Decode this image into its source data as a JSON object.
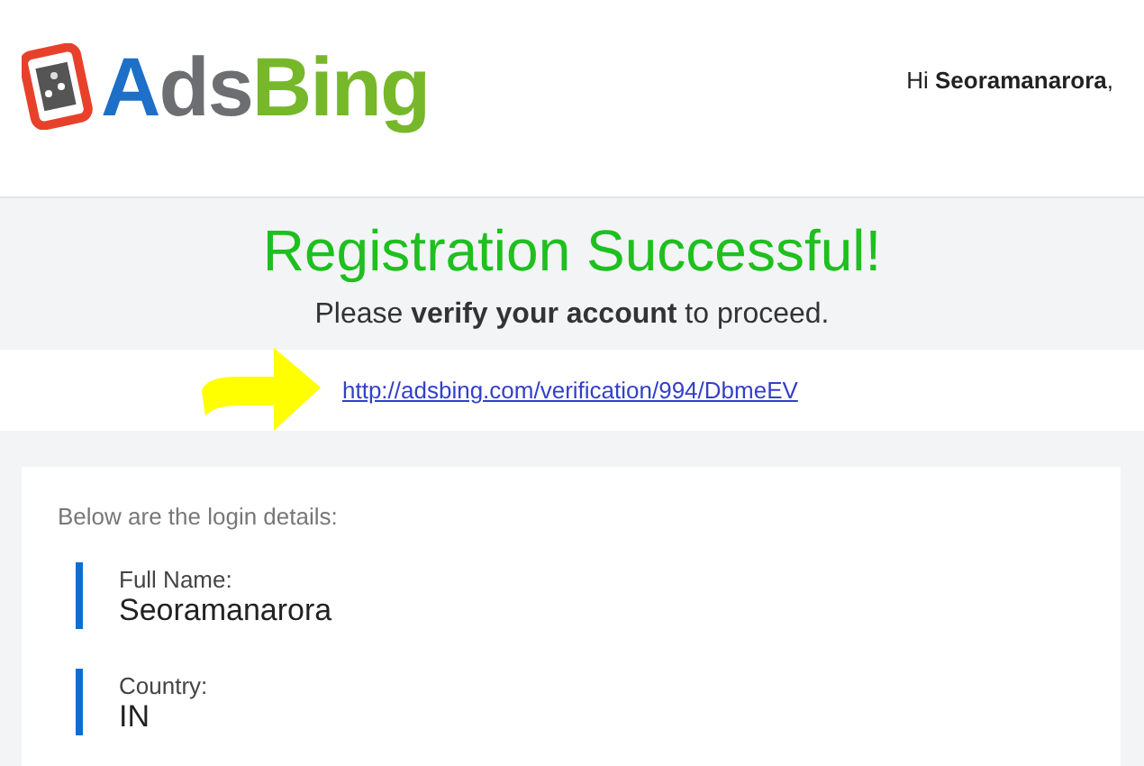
{
  "logo": [
    {
      "text": "A",
      "color": "#1e6fc8"
    },
    {
      "text": "ds",
      "color": "#6d6e71"
    },
    {
      "text": "Bing",
      "color": "#76b82a"
    }
  ],
  "greeting": "Hi **Seoramanarora**,",
  "title": "Registration Successful!",
  "subtitle": "Please **verify your account** to proceed.",
  "verification_link": "http://adsbing.com/verification/994/DbmeEV",
  "details": {
    "intro": "Below are the login details:",
    "fields": [
      {
        "label": "Full Name:",
        "value": "Seoramanarora"
      },
      {
        "label": "Country:",
        "value": "IN"
      }
    ]
  }
}
